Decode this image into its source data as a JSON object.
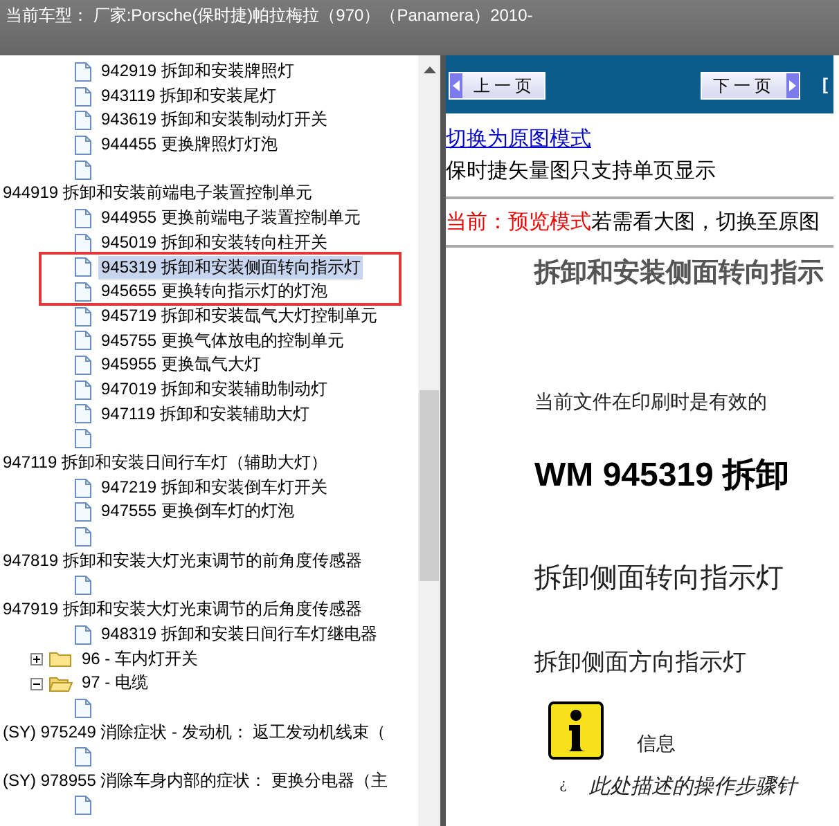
{
  "title_bar": {
    "text": "当前车型：  厂家:Porsche(保时捷)帕拉梅拉（970）（Panamera）2010-"
  },
  "tree": [
    {
      "kind": "heading",
      "children": [
        {
          "kind": "leaf",
          "label": "942919 拆卸和安装牌照灯",
          "selected": false
        },
        {
          "kind": "leaf",
          "label": "943119 拆卸和安装尾灯",
          "selected": false
        },
        {
          "kind": "leaf",
          "label": "943619 拆卸和安装制动灯开关",
          "selected": false
        },
        {
          "kind": "leaf",
          "label": "944455 更换牌照灯灯泡",
          "selected": false
        },
        {
          "kind": "leaf",
          "selected": false
        }
      ]
    },
    {
      "kind": "heading",
      "label": "944919 拆卸和安装前端电子装置控制单元",
      "children": [
        {
          "kind": "leaf",
          "label": "944955 更换前端电子装置控制单元",
          "selected": false
        },
        {
          "kind": "leaf",
          "label": "945019 拆卸和安装转向柱开关",
          "selected": false
        },
        {
          "kind": "leaf",
          "label": "945319 拆卸和安装侧面转向指示灯",
          "selected": true
        },
        {
          "kind": "leaf",
          "label": "945655 更换转向指示灯的灯泡",
          "selected": false
        },
        {
          "kind": "leaf",
          "label": "945719 拆卸和安装氙气大灯控制单元",
          "selected": false
        },
        {
          "kind": "leaf",
          "label": "945755 更换气体放电的控制单元",
          "selected": false
        },
        {
          "kind": "leaf",
          "label": "945955 更换氙气大灯",
          "selected": false
        },
        {
          "kind": "leaf",
          "label": "947019 拆卸和安装辅助制动灯",
          "selected": false
        },
        {
          "kind": "leaf",
          "label": "947119 拆卸和安装辅助大灯",
          "selected": false
        },
        {
          "kind": "leaf",
          "selected": false
        }
      ]
    },
    {
      "kind": "heading",
      "label": "947119 拆卸和安装日间行车灯（辅助大灯）",
      "children": [
        {
          "kind": "leaf",
          "label": "947219 拆卸和安装倒车灯开关",
          "selected": false
        },
        {
          "kind": "leaf",
          "label": "947555 更换倒车灯的灯泡",
          "selected": false
        },
        {
          "kind": "leaf",
          "selected": false
        }
      ]
    },
    {
      "kind": "heading",
      "label": "947819 拆卸和安装大灯光束调节的前角度传感器",
      "children": [
        {
          "kind": "leaf",
          "selected": false
        }
      ]
    },
    {
      "kind": "heading",
      "label": "947919 拆卸和安装大灯光束调节的后角度传感器",
      "children": [
        {
          "kind": "leaf",
          "label": "948319 拆卸和安装日间行车灯继电器",
          "selected": false
        }
      ]
    },
    {
      "kind": "folder",
      "label": "96 - 车内灯开关",
      "expanded": false
    },
    {
      "kind": "folder",
      "label": "97 - 电缆",
      "expanded": true,
      "children": [
        {
          "kind": "leaf",
          "selected": false
        },
        {
          "kind": "heading",
          "label": "(SY) 975249 消除症状 - 发动机： 返工发动机线束（",
          "children": [
            {
              "kind": "leaf",
              "selected": false
            }
          ]
        },
        {
          "kind": "heading",
          "label": "(SY) 978955 消除车身内部的症状： 更换分电器（主",
          "children": [
            {
              "kind": "leaf",
              "selected": false
            }
          ]
        }
      ]
    }
  ],
  "toolbar": {
    "prev_button": "上一页",
    "next_button": "下一页",
    "link": "["
  },
  "switch_link": "切换为原图模式",
  "note": "保时捷矢量图只支持单页显示",
  "mode": {
    "label": "当前：预览模式",
    "hint": "若需看大图，切换至原图"
  },
  "document": {
    "header": "拆卸和安装侧面转向指示",
    "validity": "当前文件在印刷时是有效的",
    "title": "WM 945319 拆卸",
    "heading": "拆卸侧面转向指示灯",
    "subheading": "拆卸侧面方向指示灯",
    "info_label": "信息",
    "bullet": "¿",
    "text": "此处描述的操作步骤针"
  }
}
